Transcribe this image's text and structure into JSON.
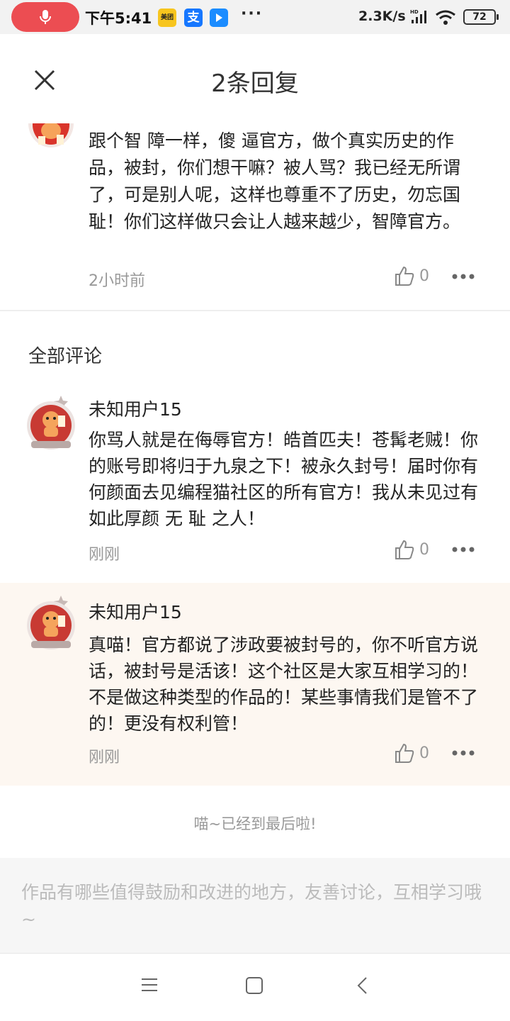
{
  "status_bar": {
    "time": "下午5:41",
    "meituan_label": "美团",
    "alipay_label": "支",
    "more": "···",
    "network_speed": "2.3K/s",
    "battery": "72"
  },
  "header": {
    "title": "2条回复"
  },
  "original_comment": {
    "text": "跟个智 障一样，傻 逼官方，做个真实历史的作品，被封，你们想干嘛？被人骂？我已经无所谓了，可是别人呢，这样也尊重不了历史，勿忘国耻！你们这样做只会让人越来越少，智障官方。",
    "time": "2小时前",
    "likes": "0"
  },
  "section": {
    "title": "全部评论"
  },
  "comments": [
    {
      "user": "未知用户15",
      "text": "你骂人就是在侮辱官方！皓首匹夫！苍髯老贼！你的账号即将归于九泉之下！被永久封号！届时你有何颜面去见编程猫社区的所有官方！我从未见过有如此厚颜 无 耻 之人！",
      "time": "刚刚",
      "likes": "0"
    },
    {
      "user": "未知用户15",
      "text": "真喵！官方都说了涉政要被封号的，你不听官方说话，被封号是活该！这个社区是大家互相学习的！不是做这种类型的作品的！某些事情我们是管不了的！更没有权利管！",
      "time": "刚刚",
      "likes": "0"
    }
  ],
  "end_note": "喵~已经到最后啦!",
  "input": {
    "placeholder": "作品有哪些值得鼓励和改进的地方，友善讨论，互相学习哦~"
  },
  "colors": {
    "mic_red": "#ec4d52",
    "highlight_bg": "#fdf7f1",
    "muted_text": "#999999"
  }
}
